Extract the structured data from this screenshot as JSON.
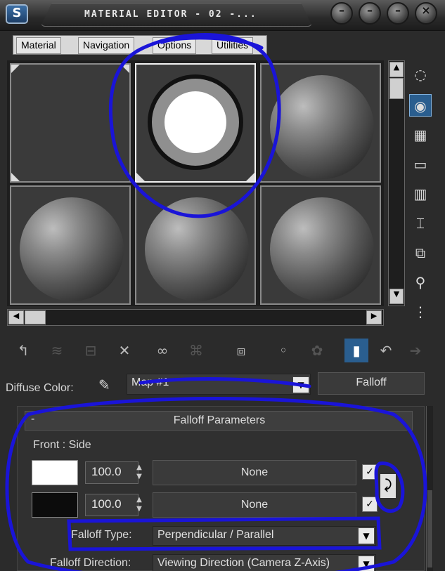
{
  "window": {
    "title": "MATERIAL EDITOR - 02 -..."
  },
  "menu": [
    "Material",
    "Navigation",
    "Options",
    "Utilities"
  ],
  "icons": {
    "app": "max-app-icon",
    "window_buttons": [
      "minimize-icon",
      "restore-icon",
      "maximize-icon",
      "close-icon"
    ]
  },
  "diffuse": {
    "label": "Diffuse Color:",
    "map_name": "Map #1",
    "map_type": "Falloff"
  },
  "falloff_params": {
    "header": "Falloff Parameters",
    "collapse_symbol": "-",
    "section_label": "Front : Side",
    "rows": [
      {
        "color": "#ffffff",
        "amount": "100.0",
        "map": "None",
        "checked": true
      },
      {
        "color": "#0c0c0c",
        "amount": "100.0",
        "map": "None",
        "checked": true
      }
    ],
    "falloff_type_label": "Falloff Type:",
    "falloff_type_value": "Perpendicular / Parallel",
    "falloff_direction_label": "Falloff Direction:",
    "falloff_direction_value": "Viewing Direction (Camera Z-Axis)"
  },
  "colors": {
    "annotation": "#1a14d8",
    "panel": "#2b2b2b"
  }
}
